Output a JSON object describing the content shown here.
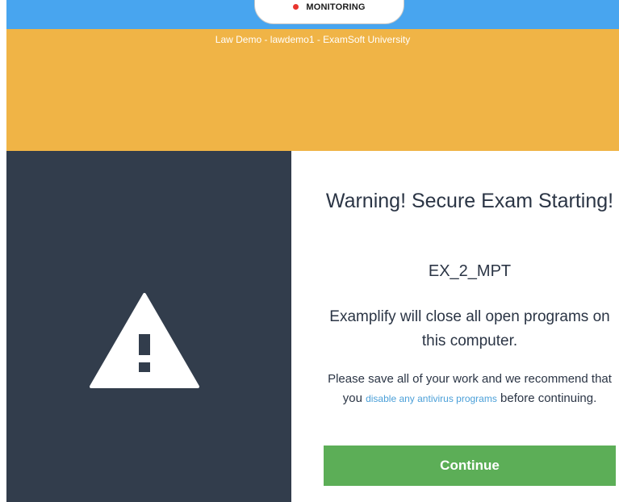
{
  "monitoring": {
    "label": "MONITORING",
    "indicator_color": "#e8352e"
  },
  "header": {
    "subtitle": "Law Demo - lawdemo1 - ExamSoft University"
  },
  "warning": {
    "icon": "warning-triangle-icon",
    "title": "Warning! Secure Exam Starting!",
    "exam_code": "EX_2_MPT",
    "message": "Examplify will close all open programs on this computer.",
    "note_before": "Please save all of your work and we recommend that you ",
    "note_link": "disable any antivirus programs",
    "note_after": " before continuing.",
    "continue_label": "Continue"
  },
  "colors": {
    "top_bar": "#48a5ef",
    "header": "#f0b446",
    "left_panel": "#323d4c",
    "button": "#5cae57",
    "link": "#4a9fd8",
    "text": "#2b3545"
  }
}
